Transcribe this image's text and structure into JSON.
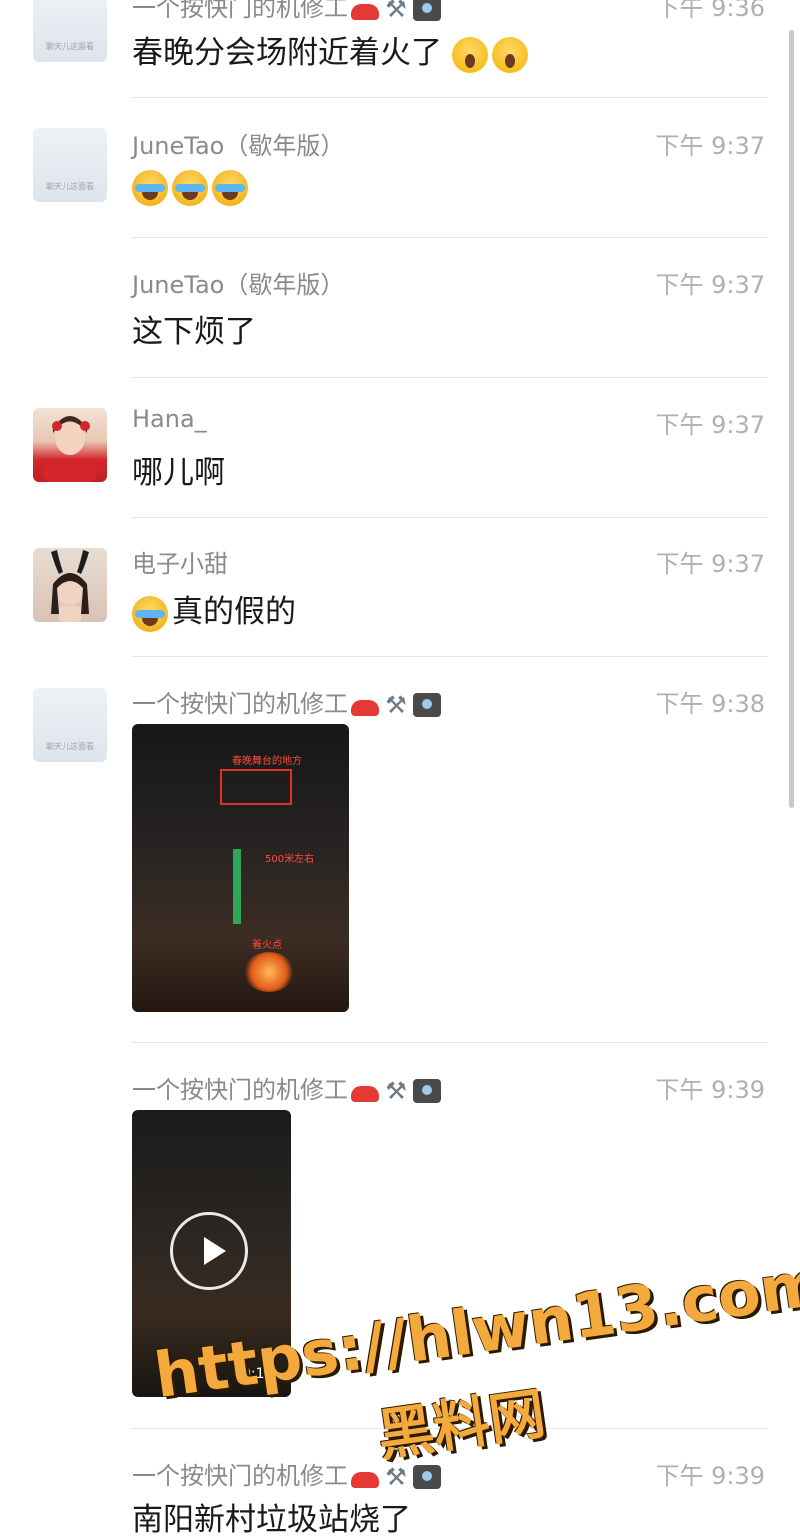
{
  "messages": [
    {
      "sender": "一个按快门的机修工",
      "time": "下午 9:36",
      "text": "春晚分会场附近着火了",
      "avatar_caption": "聊天儿这面看"
    },
    {
      "sender": "JuneTao（歇年版）",
      "time": "下午 9:37",
      "text": "",
      "avatar_caption": "聊天儿这面看"
    },
    {
      "sender": "JuneTao（歇年版）",
      "time": "下午 9:37",
      "text": "这下烦了"
    },
    {
      "sender": "Hana_",
      "time": "下午 9:37",
      "text": "哪儿啊"
    },
    {
      "sender": "电子小甜",
      "time": "下午 9:37",
      "text": "真的假的"
    },
    {
      "sender": "一个按快门的机修工",
      "time": "下午 9:38",
      "avatar_caption": "聊天儿这面看",
      "image_labels": {
        "stage": "春晚舞台的地方",
        "distance": "500米左右",
        "fire": "着火点"
      }
    },
    {
      "sender": "一个按快门的机修工",
      "time": "下午 9:39",
      "video_duration": "0:14"
    },
    {
      "sender": "一个按快门的机修工",
      "time": "下午 9:39",
      "text": "南阳新村垃圾站烧了"
    }
  ],
  "watermark": {
    "line1": "https://hlwn13.com",
    "line2": "黑料网"
  },
  "icons": {
    "scream": "face-screaming-in-fear-icon",
    "cry": "loudly-crying-face-icon",
    "car": "red-car-icon",
    "tools": "hammer-and-wrench-icon",
    "camera": "camera-with-flash-icon"
  },
  "colors": {
    "sender": "#8a8a8a",
    "time": "#b0b0b0",
    "watermark": "#f3a93b"
  }
}
